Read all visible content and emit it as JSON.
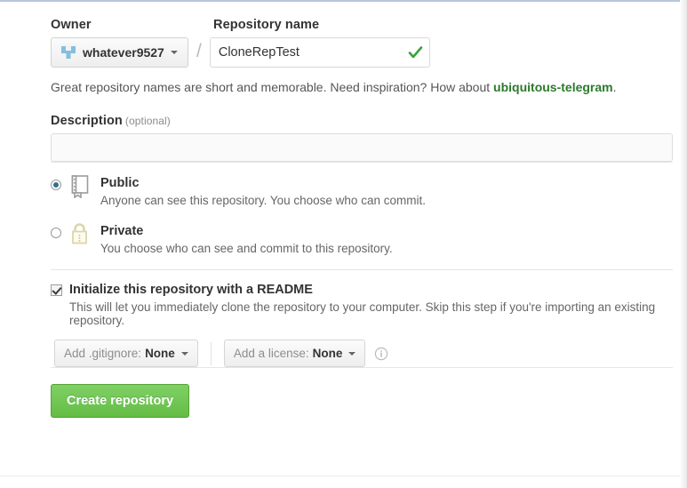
{
  "form": {
    "owner": {
      "label": "Owner",
      "name": "whatever9527",
      "avatar_icon": "identicon-avatar"
    },
    "separator": "/",
    "repository": {
      "label": "Repository name",
      "value": "CloneRepTest",
      "placeholder": "",
      "valid_icon": "green-check-icon"
    },
    "hint": {
      "text_before": "Great repository names are short and memorable. Need inspiration? How about ",
      "suggestion": "ubiquitous-telegram",
      "text_after": ".",
      "suggestion_color": "#2b7a2b"
    },
    "description": {
      "label": "Description",
      "optional_label": "(optional)",
      "value": "",
      "placeholder": ""
    },
    "visibility": {
      "options": [
        {
          "id": "public",
          "title": "Public",
          "subtitle": "Anyone can see this repository. You choose who can commit.",
          "icon": "repo-book-icon",
          "selected": true
        },
        {
          "id": "private",
          "title": "Private",
          "subtitle": "You choose who can see and commit to this repository.",
          "icon": "lock-icon",
          "selected": false
        }
      ]
    },
    "readme": {
      "title": "Initialize this repository with a README",
      "subtitle": "This will let you immediately clone the repository to your computer. Skip this step if you're importing an existing repository.",
      "checked": true
    },
    "gitignore": {
      "label": "Add .gitignore:",
      "value": "None"
    },
    "license": {
      "label": "Add a license:",
      "value": "None"
    },
    "info_icon": "info-circle-icon",
    "submit": {
      "label": "Create repository",
      "color": "#64bd45"
    }
  }
}
